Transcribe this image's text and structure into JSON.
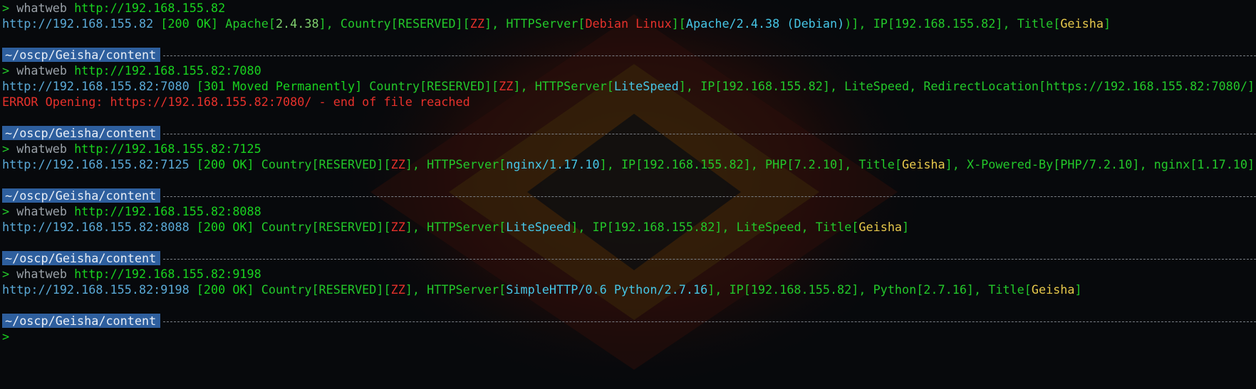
{
  "colors": {
    "prompt_bg": "#2e5f9e",
    "green": "#19d21f",
    "url_blue": "#5aa9d6",
    "cyan": "#46c6e6",
    "red": "#e6312b",
    "yellow": "#e6c84b"
  },
  "prompt": {
    "path": "~/oscp/Geisha/content",
    "caret": ">"
  },
  "blocks": [
    {
      "cmd": "whatweb",
      "arg": "http://192.168.155.82",
      "out": {
        "url": "http://192.168.155.82",
        "status": "[200 OK]",
        "apache_open": "Apache[",
        "apache_ver": "2.4.38",
        "apache_close": "],",
        "country": "Country[RESERVED][",
        "zz": "ZZ",
        "country_close": "],",
        "httpserver": "HTTPServer[",
        "os": "Debian Linux",
        "hs_mid": "][",
        "server": "Apache/2.4.38 (Debian)",
        "hs_close": ")],",
        "ip": "IP[192.168.155.82],",
        "title_open": "Title[",
        "title": "Geisha",
        "title_close": "]"
      }
    },
    {
      "cmd": "whatweb",
      "arg": "http://192.168.155.82:7080",
      "out": {
        "url": "http://192.168.155.82:7080",
        "status": "[301 Moved Permanently]",
        "country": "Country[RESERVED][",
        "zz": "ZZ",
        "country_close": "],",
        "httpserver": "HTTPServer[",
        "server": "LiteSpeed",
        "hs_close": "],",
        "ip": "IP[192.168.155.82],",
        "litespeed": "LiteSpeed,",
        "redirect": "RedirectLocation[https://192.168.155.82:7080/]"
      },
      "error": "ERROR Opening: https://192.168.155.82:7080/ - end of file reached"
    },
    {
      "cmd": "whatweb",
      "arg": "http://192.168.155.82:7125",
      "out": {
        "url": "http://192.168.155.82:7125",
        "status": "[200 OK]",
        "country": "Country[RESERVED][",
        "zz": "ZZ",
        "country_close": "],",
        "httpserver": "HTTPServer[",
        "server": "nginx/1.17.10",
        "hs_close": "],",
        "ip": "IP[192.168.155.82],",
        "php": "PHP[7.2.10],",
        "title_open": "Title[",
        "title": "Geisha",
        "title_close": "],",
        "xpb": "X-Powered-By[PHP/7.2.10],",
        "nginx": "nginx[1.17.10]"
      }
    },
    {
      "cmd": "whatweb",
      "arg": "http://192.168.155.82:8088",
      "out": {
        "url": "http://192.168.155.82:8088",
        "status": "[200 OK]",
        "country": "Country[RESERVED][",
        "zz": "ZZ",
        "country_close": "],",
        "httpserver": "HTTPServer[",
        "server": "LiteSpeed",
        "hs_close": "],",
        "ip": "IP[192.168.155.82],",
        "litespeed": "LiteSpeed,",
        "title_open": "Title[",
        "title": "Geisha",
        "title_close": "]"
      }
    },
    {
      "cmd": "whatweb",
      "arg": "http://192.168.155.82:9198",
      "out": {
        "url": "http://192.168.155.82:9198",
        "status": "[200 OK]",
        "country": "Country[RESERVED][",
        "zz": "ZZ",
        "country_close": "],",
        "httpserver": "HTTPServer[",
        "server": "SimpleHTTP/0.6 Python/2.7.16",
        "hs_close": "],",
        "ip": "IP[192.168.155.82],",
        "python": "Python[2.7.16],",
        "title_open": "Title[",
        "title": "Geisha",
        "title_close": "]"
      }
    }
  ]
}
